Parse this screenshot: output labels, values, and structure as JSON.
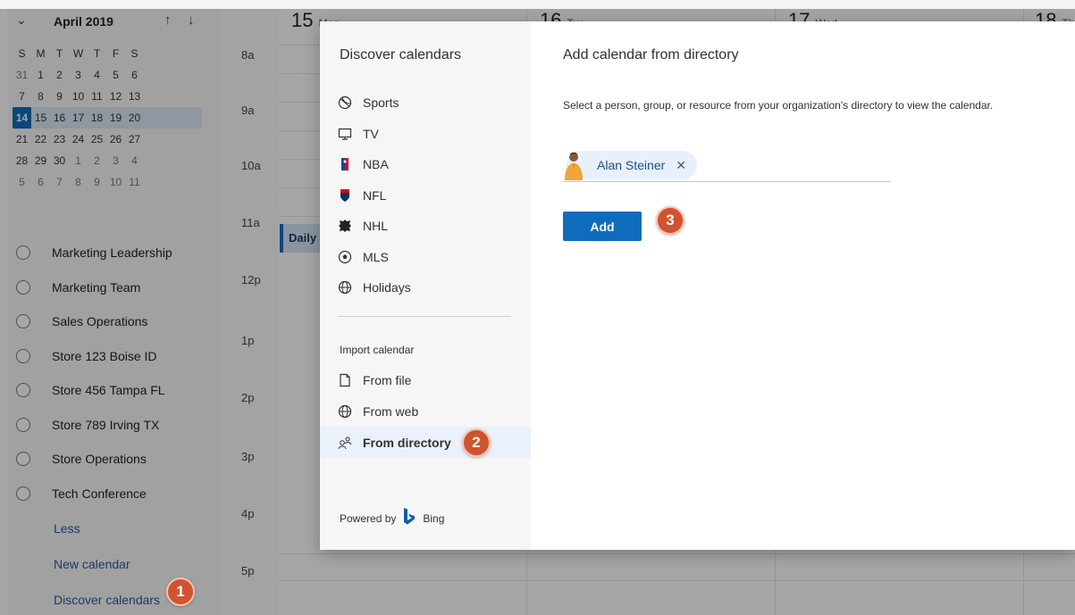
{
  "mini_calendar": {
    "month_label": "April 2019",
    "weekday_headers": [
      "S",
      "M",
      "T",
      "W",
      "T",
      "F",
      "S"
    ],
    "weeks": [
      [
        "31",
        "1",
        "2",
        "3",
        "4",
        "5",
        "6"
      ],
      [
        "7",
        "8",
        "9",
        "10",
        "11",
        "12",
        "13"
      ],
      [
        "14",
        "15",
        "16",
        "17",
        "18",
        "19",
        "20"
      ],
      [
        "21",
        "22",
        "23",
        "24",
        "25",
        "26",
        "27"
      ],
      [
        "28",
        "29",
        "30",
        "1",
        "2",
        "3",
        "4"
      ],
      [
        "5",
        "6",
        "7",
        "8",
        "9",
        "10",
        "11"
      ]
    ],
    "today": "14"
  },
  "calendars": [
    "Marketing Leadership",
    "Marketing Team",
    "Sales Operations",
    "Store 123 Boise ID",
    "Store 456 Tampa FL",
    "Store 789 Irving TX",
    "Store Operations",
    "Tech Conference"
  ],
  "left_links": {
    "less": "Less",
    "new_calendar": "New calendar",
    "discover_calendars": "Discover calendars"
  },
  "time_labels": [
    "8a",
    "9a",
    "10a",
    "11a",
    "12p",
    "1p",
    "2p",
    "3p",
    "4p",
    "5p"
  ],
  "day_headers": [
    {
      "num": "15",
      "name": "Mon"
    },
    {
      "num": "16",
      "name": "Tue"
    },
    {
      "num": "17",
      "name": "Wed"
    },
    {
      "num": "18",
      "name": "Th"
    }
  ],
  "event": {
    "title": "Daily"
  },
  "dialog": {
    "left_title": "Discover calendars",
    "discover_items": [
      {
        "label": "Sports",
        "icon": "sports-icon"
      },
      {
        "label": "TV",
        "icon": "tv-icon"
      },
      {
        "label": "NBA",
        "icon": "nba-icon"
      },
      {
        "label": "NFL",
        "icon": "nfl-icon"
      },
      {
        "label": "NHL",
        "icon": "nhl-icon"
      },
      {
        "label": "MLS",
        "icon": "mls-icon"
      },
      {
        "label": "Holidays",
        "icon": "globe-icon"
      }
    ],
    "import_title": "Import calendar",
    "import_items": [
      {
        "label": "From file",
        "icon": "file-icon"
      },
      {
        "label": "From web",
        "icon": "globe-icon"
      },
      {
        "label": "From directory",
        "icon": "people-icon",
        "selected": true
      }
    ],
    "powered_by": "Powered by",
    "bing": "Bing",
    "right_title": "Add calendar from directory",
    "description": "Select a person, group, or resource from your organization's directory to view the calendar.",
    "selected_person": "Alan Steiner",
    "add_label": "Add"
  },
  "steps": [
    "1",
    "2",
    "3"
  ],
  "colors": {
    "accent": "#0f6cbd",
    "step_marker": "#d0532f",
    "chip_bg": "#e8f0fb"
  }
}
